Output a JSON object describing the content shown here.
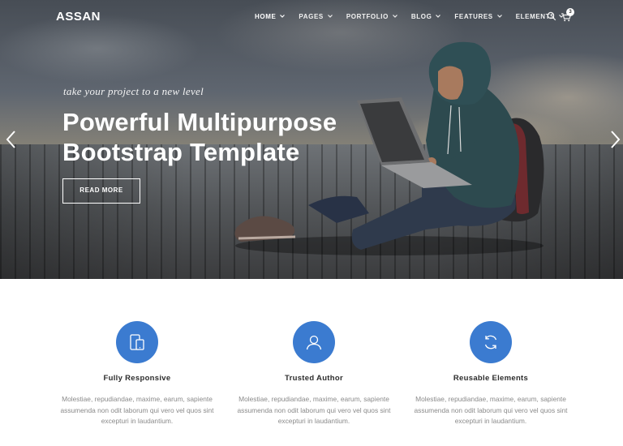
{
  "brand": {
    "logo": "ASSAN",
    "accent": "#3b7bd0"
  },
  "nav": {
    "items": [
      {
        "label": "HOME",
        "active": true
      },
      {
        "label": "PAGES"
      },
      {
        "label": "PORTFOLIO"
      },
      {
        "label": "BLOG"
      },
      {
        "label": "FEATURES"
      },
      {
        "label": "ELEMENTS"
      }
    ],
    "search_icon": "search-icon",
    "cart_icon": "cart-icon",
    "cart_count": "3"
  },
  "hero": {
    "tagline": "take your project to a new level",
    "headline_line1": "Powerful Multipurpose",
    "headline_line2": "Bootstrap Template",
    "button_label": "READ MORE",
    "prev_icon": "chevron-left-icon",
    "next_icon": "chevron-right-icon"
  },
  "features": [
    {
      "icon": "devices-icon",
      "title": "Fully Responsive",
      "text": "Molestiae, repudiandae, maxime, earum, sapiente assumenda non odit laborum qui vero vel quos sint excepturi in laudantium."
    },
    {
      "icon": "user-icon",
      "title": "Trusted Author",
      "text": "Molestiae, repudiandae, maxime, earum, sapiente assumenda non odit laborum qui vero vel quos sint excepturi in laudantium."
    },
    {
      "icon": "refresh-icon",
      "title": "Reusable Elements",
      "text": "Molestiae, repudiandae, maxime, earum, sapiente assumenda non odit laborum qui vero vel quos sint excepturi in laudantium."
    }
  ]
}
